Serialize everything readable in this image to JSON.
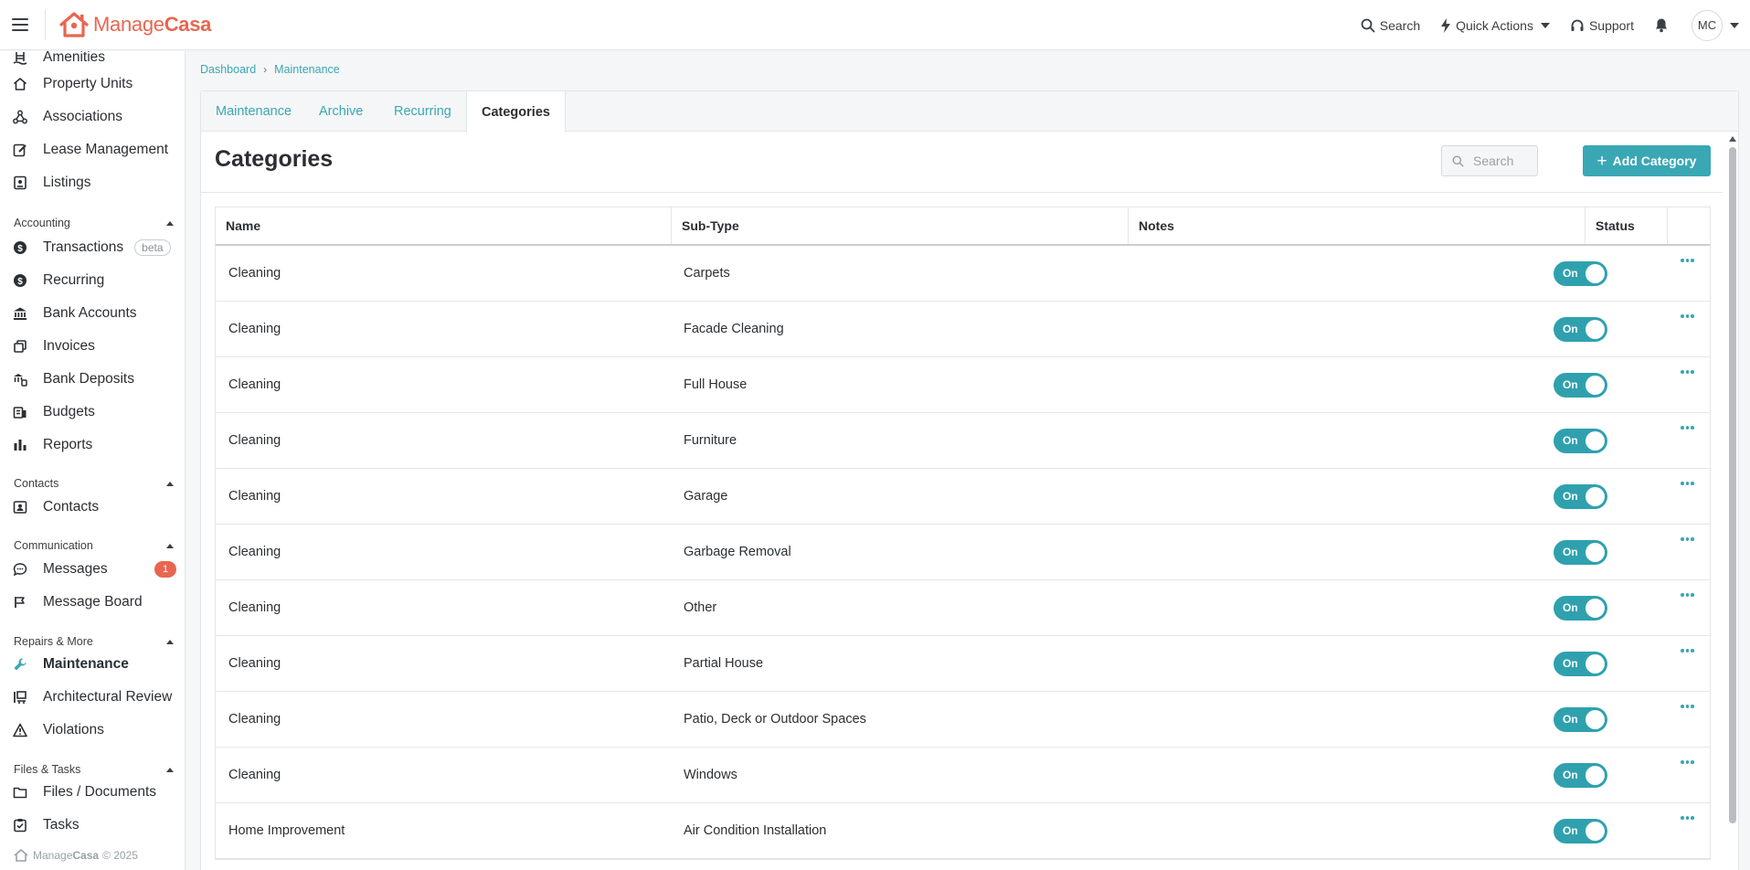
{
  "brand": {
    "name_light": "Manage",
    "name_bold": "Casa",
    "color": "#e8664f",
    "accent": "#3aa7b4"
  },
  "topbar": {
    "search_label": "Search",
    "quick_actions_label": "Quick Actions",
    "support_label": "Support",
    "avatar_initials": "MC"
  },
  "sidebar": {
    "items_top": [
      {
        "label": "Amenities",
        "icon": "amenities-icon"
      },
      {
        "label": "Property Units",
        "icon": "home-icon"
      },
      {
        "label": "Associations",
        "icon": "network-icon"
      },
      {
        "label": "Lease Management",
        "icon": "edit-document-icon"
      },
      {
        "label": "Listings",
        "icon": "listing-icon"
      }
    ],
    "accounting": {
      "title": "Accounting",
      "items": [
        {
          "label": "Transactions",
          "icon": "dollar-circle-icon",
          "badge": "beta"
        },
        {
          "label": "Recurring",
          "icon": "dollar-circle-icon"
        },
        {
          "label": "Bank Accounts",
          "icon": "bank-icon"
        },
        {
          "label": "Invoices",
          "icon": "invoice-icon"
        },
        {
          "label": "Bank Deposits",
          "icon": "deposit-icon"
        },
        {
          "label": "Budgets",
          "icon": "budget-icon"
        },
        {
          "label": "Reports",
          "icon": "bar-chart-icon"
        }
      ]
    },
    "contacts": {
      "title": "Contacts",
      "items": [
        {
          "label": "Contacts",
          "icon": "contact-card-icon"
        }
      ]
    },
    "communication": {
      "title": "Communication",
      "items": [
        {
          "label": "Messages",
          "icon": "chat-icon",
          "count": "1"
        },
        {
          "label": "Message Board",
          "icon": "message-board-icon"
        }
      ]
    },
    "repairs": {
      "title": "Repairs & More",
      "items": [
        {
          "label": "Maintenance",
          "icon": "wrench-icon",
          "active": true
        },
        {
          "label": "Architectural Review",
          "icon": "review-icon"
        },
        {
          "label": "Violations",
          "icon": "warning-icon"
        }
      ]
    },
    "files": {
      "title": "Files & Tasks",
      "items": [
        {
          "label": "Files / Documents",
          "icon": "folder-icon"
        },
        {
          "label": "Tasks",
          "icon": "task-icon"
        }
      ]
    },
    "footer": {
      "brand_light": "Manage",
      "brand_bold": "Casa",
      "copyright": "© 2025"
    }
  },
  "breadcrumb": {
    "items": [
      "Dashboard",
      "Maintenance"
    ]
  },
  "tabs": [
    {
      "label": "Maintenance",
      "active": false
    },
    {
      "label": "Archive",
      "active": false
    },
    {
      "label": "Recurring",
      "active": false
    },
    {
      "label": "Categories",
      "active": true
    }
  ],
  "page": {
    "title": "Categories",
    "search_placeholder": "Search",
    "add_button_label": "Add Category"
  },
  "table": {
    "columns": [
      "Name",
      "Sub-Type",
      "Notes",
      "Status"
    ],
    "rows": [
      {
        "name": "Cleaning",
        "subtype": "Carpets",
        "notes": "",
        "status": "On"
      },
      {
        "name": "Cleaning",
        "subtype": "Facade Cleaning",
        "notes": "",
        "status": "On"
      },
      {
        "name": "Cleaning",
        "subtype": "Full House",
        "notes": "",
        "status": "On"
      },
      {
        "name": "Cleaning",
        "subtype": "Furniture",
        "notes": "",
        "status": "On"
      },
      {
        "name": "Cleaning",
        "subtype": "Garage",
        "notes": "",
        "status": "On"
      },
      {
        "name": "Cleaning",
        "subtype": "Garbage Removal",
        "notes": "",
        "status": "On"
      },
      {
        "name": "Cleaning",
        "subtype": "Other",
        "notes": "",
        "status": "On"
      },
      {
        "name": "Cleaning",
        "subtype": "Partial House",
        "notes": "",
        "status": "On"
      },
      {
        "name": "Cleaning",
        "subtype": "Patio, Deck or Outdoor Spaces",
        "notes": "",
        "status": "On"
      },
      {
        "name": "Cleaning",
        "subtype": "Windows",
        "notes": "",
        "status": "On"
      },
      {
        "name": "Home Improvement",
        "subtype": "Air Condition Installation",
        "notes": "",
        "status": "On"
      }
    ]
  }
}
